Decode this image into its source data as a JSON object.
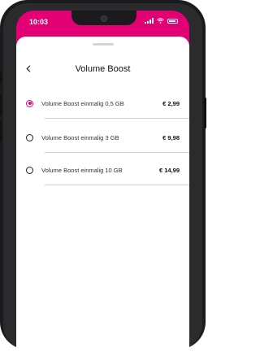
{
  "status_bar": {
    "time": "10:03"
  },
  "header": {
    "back_icon": "chevron-left-icon",
    "title": "Volume Boost"
  },
  "options": [
    {
      "label": "Volume Boost einmalig 0,5 GB",
      "price": "€ 2,99",
      "selected": true
    },
    {
      "label": "Volume Boost einmalig 3 GB",
      "price": "€ 9,98",
      "selected": false
    },
    {
      "label": "Volume Boost einmalig 10 GB",
      "price": "€ 14,99",
      "selected": false
    }
  ],
  "colors": {
    "accent": "#e20074"
  }
}
